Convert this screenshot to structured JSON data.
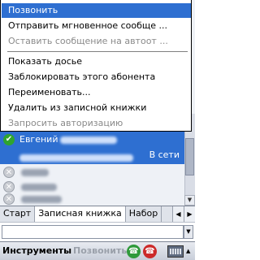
{
  "menu": {
    "items": [
      {
        "label": "Позвонить"
      },
      {
        "label": "Отправить мгновенное сообще ..."
      },
      {
        "label": "Оставить сообщение на автоот ..."
      },
      {
        "label": "Показать досье"
      },
      {
        "label": "Заблокировать этого абонента"
      },
      {
        "label": "Переименовать..."
      },
      {
        "label": "Удалить из записной книжки"
      },
      {
        "label": "Запросить авторизацию"
      }
    ]
  },
  "contacts": {
    "selected": {
      "name": "Евгений",
      "status": "В сети"
    }
  },
  "tabs": [
    {
      "label": "Старт"
    },
    {
      "label": "Записная книжка"
    },
    {
      "label": "Набор"
    }
  ],
  "softkeys": {
    "left": "Инструменты",
    "center": "Позвонить"
  },
  "colors": {
    "highlight": "#2e6fd1",
    "online": "#2fa42f",
    "call": "#2f9a3b",
    "hangup": "#cc2a2a"
  },
  "icons": {
    "menu_selected_check": "check-icon",
    "call": "phone-icon",
    "hangup": "hangup-icon",
    "keyboard": "keyboard-icon"
  }
}
